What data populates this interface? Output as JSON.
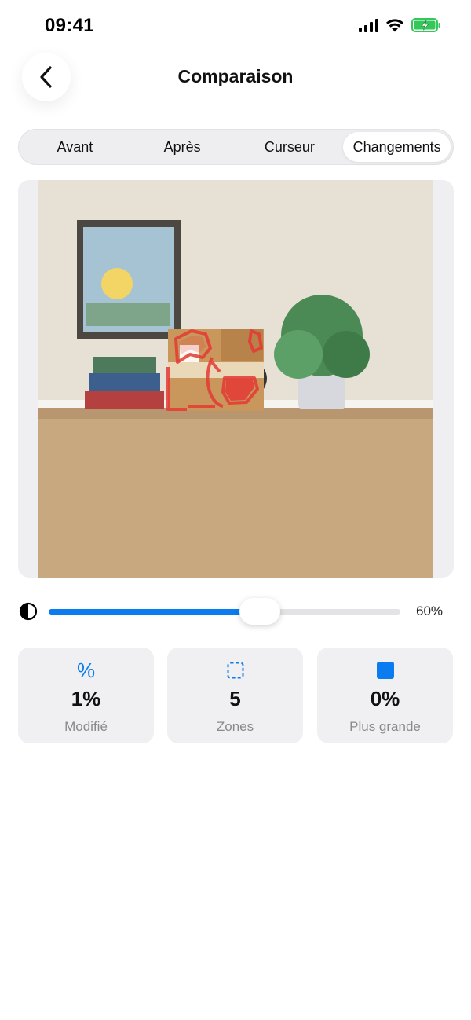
{
  "status": {
    "time": "09:41",
    "icons": [
      "cellular-signal-icon",
      "wifi-icon",
      "battery-charging-icon"
    ]
  },
  "header": {
    "title": "Comparaison",
    "back_icon": "chevron-left-icon"
  },
  "tabs": [
    {
      "label": "Avant",
      "active": false
    },
    {
      "label": "Après",
      "active": false
    },
    {
      "label": "Curseur",
      "active": false
    },
    {
      "label": "Changements",
      "active": true
    }
  ],
  "image": {
    "description_icon": "scene-image",
    "highlight_color": "#e53935"
  },
  "slider": {
    "icon": "contrast-icon",
    "value": 0.6,
    "value_label": "60%"
  },
  "stats": [
    {
      "icon": "percent-icon",
      "value": "1%",
      "label": "Modifié"
    },
    {
      "icon": "dashed-square-icon",
      "value": "5",
      "label": "Zones"
    },
    {
      "icon": "filled-square-icon",
      "value": "0%",
      "label": "Plus grande"
    }
  ],
  "colors": {
    "accent": "#0a7cf0",
    "card_bg": "#f0f0f2",
    "label_gray": "#8a8a8e"
  }
}
